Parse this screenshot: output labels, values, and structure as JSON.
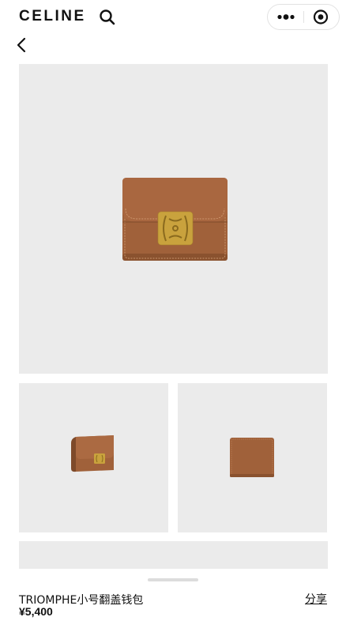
{
  "header": {
    "brand": "CELINE",
    "search_icon": "search-icon",
    "more_icon": "more-dots-icon",
    "close_icon": "target-circle-icon"
  },
  "nav": {
    "back_icon": "chevron-left-icon"
  },
  "gallery": {
    "main_image_alt": "wallet front view",
    "thumbnails": [
      {
        "icon": "wallet-angle-view"
      },
      {
        "icon": "wallet-back-view"
      }
    ]
  },
  "product": {
    "name": "TRIOMPHE小号翻盖钱包",
    "price": "¥5,400",
    "share_label": "分享"
  },
  "colors": {
    "background": "#ffffff",
    "image_bg": "#ebebeb",
    "leather": "#a0613a",
    "leather_dark": "#7e4a2a",
    "gold": "#c9a23d",
    "text": "#111111"
  }
}
